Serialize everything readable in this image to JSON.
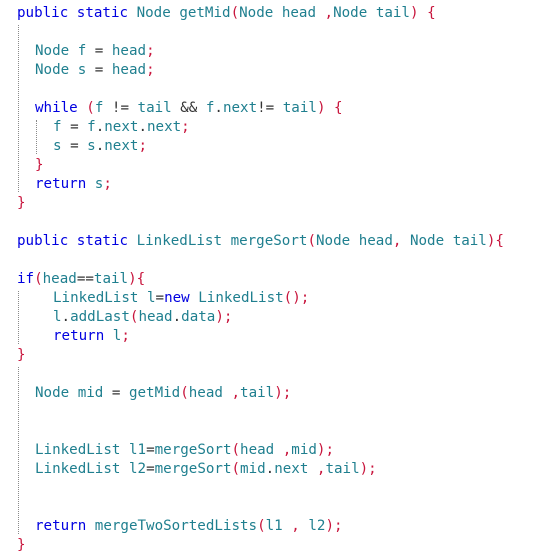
{
  "theme": {
    "keyword": "#0000e0",
    "identifier": "#1f7f8f",
    "punctuation": "#c8143c",
    "operator": "#333333",
    "background": "#ffffff"
  },
  "lines": [
    {
      "indent": 0,
      "tokens": [
        {
          "t": "public",
          "k": "kw"
        },
        {
          "t": " ",
          "k": "plain"
        },
        {
          "t": "static",
          "k": "kw"
        },
        {
          "t": " ",
          "k": "plain"
        },
        {
          "t": "Node",
          "k": "id"
        },
        {
          "t": " ",
          "k": "plain"
        },
        {
          "t": "getMid",
          "k": "id"
        },
        {
          "t": "(",
          "k": "punc"
        },
        {
          "t": "Node",
          "k": "id"
        },
        {
          "t": " ",
          "k": "plain"
        },
        {
          "t": "head",
          "k": "id"
        },
        {
          "t": " ,",
          "k": "punc"
        },
        {
          "t": "Node",
          "k": "id"
        },
        {
          "t": " ",
          "k": "plain"
        },
        {
          "t": "tail",
          "k": "id"
        },
        {
          "t": ")",
          "k": "punc"
        },
        {
          "t": " ",
          "k": "plain"
        },
        {
          "t": "{",
          "k": "punc"
        }
      ]
    },
    {
      "indent": 0,
      "tokens": []
    },
    {
      "indent": 1,
      "tokens": [
        {
          "t": "Node",
          "k": "id"
        },
        {
          "t": " ",
          "k": "plain"
        },
        {
          "t": "f",
          "k": "id"
        },
        {
          "t": " = ",
          "k": "op"
        },
        {
          "t": "head",
          "k": "id"
        },
        {
          "t": ";",
          "k": "punc"
        }
      ]
    },
    {
      "indent": 1,
      "tokens": [
        {
          "t": "Node",
          "k": "id"
        },
        {
          "t": " ",
          "k": "plain"
        },
        {
          "t": "s",
          "k": "id"
        },
        {
          "t": " = ",
          "k": "op"
        },
        {
          "t": "head",
          "k": "id"
        },
        {
          "t": ";",
          "k": "punc"
        }
      ]
    },
    {
      "indent": 0,
      "tokens": []
    },
    {
      "indent": 1,
      "tokens": [
        {
          "t": "while",
          "k": "kw"
        },
        {
          "t": " ",
          "k": "plain"
        },
        {
          "t": "(",
          "k": "punc"
        },
        {
          "t": "f",
          "k": "id"
        },
        {
          "t": " != ",
          "k": "op"
        },
        {
          "t": "tail",
          "k": "id"
        },
        {
          "t": " && ",
          "k": "op"
        },
        {
          "t": "f",
          "k": "id"
        },
        {
          "t": ".",
          "k": "op"
        },
        {
          "t": "next",
          "k": "id"
        },
        {
          "t": "!= ",
          "k": "op"
        },
        {
          "t": "tail",
          "k": "id"
        },
        {
          "t": ")",
          "k": "punc"
        },
        {
          "t": " ",
          "k": "plain"
        },
        {
          "t": "{",
          "k": "punc"
        }
      ]
    },
    {
      "indent": 2,
      "tokens": [
        {
          "t": "f",
          "k": "id"
        },
        {
          "t": " = ",
          "k": "op"
        },
        {
          "t": "f",
          "k": "id"
        },
        {
          "t": ".",
          "k": "op"
        },
        {
          "t": "next",
          "k": "id"
        },
        {
          "t": ".",
          "k": "op"
        },
        {
          "t": "next",
          "k": "id"
        },
        {
          "t": ";",
          "k": "punc"
        }
      ]
    },
    {
      "indent": 2,
      "tokens": [
        {
          "t": "s",
          "k": "id"
        },
        {
          "t": " = ",
          "k": "op"
        },
        {
          "t": "s",
          "k": "id"
        },
        {
          "t": ".",
          "k": "op"
        },
        {
          "t": "next",
          "k": "id"
        },
        {
          "t": ";",
          "k": "punc"
        }
      ]
    },
    {
      "indent": 1,
      "tokens": [
        {
          "t": "}",
          "k": "punc"
        }
      ]
    },
    {
      "indent": 1,
      "tokens": [
        {
          "t": "return",
          "k": "kw"
        },
        {
          "t": " ",
          "k": "plain"
        },
        {
          "t": "s",
          "k": "id"
        },
        {
          "t": ";",
          "k": "punc"
        }
      ]
    },
    {
      "indent": 0,
      "tokens": [
        {
          "t": "}",
          "k": "punc"
        }
      ]
    },
    {
      "indent": 0,
      "tokens": []
    },
    {
      "indent": 0,
      "tokens": [
        {
          "t": "public",
          "k": "kw"
        },
        {
          "t": " ",
          "k": "plain"
        },
        {
          "t": "static",
          "k": "kw"
        },
        {
          "t": " ",
          "k": "plain"
        },
        {
          "t": "LinkedList",
          "k": "id"
        },
        {
          "t": " ",
          "k": "plain"
        },
        {
          "t": "mergeSort",
          "k": "id"
        },
        {
          "t": "(",
          "k": "punc"
        },
        {
          "t": "Node",
          "k": "id"
        },
        {
          "t": " ",
          "k": "plain"
        },
        {
          "t": "head",
          "k": "id"
        },
        {
          "t": ", ",
          "k": "punc"
        },
        {
          "t": "Node",
          "k": "id"
        },
        {
          "t": " ",
          "k": "plain"
        },
        {
          "t": "tail",
          "k": "id"
        },
        {
          "t": ")",
          "k": "punc"
        },
        {
          "t": "{",
          "k": "punc"
        }
      ]
    },
    {
      "indent": 0,
      "tokens": []
    },
    {
      "indent": 0,
      "tokens": [
        {
          "t": "if",
          "k": "kw"
        },
        {
          "t": "(",
          "k": "punc"
        },
        {
          "t": "head",
          "k": "id"
        },
        {
          "t": "==",
          "k": "op"
        },
        {
          "t": "tail",
          "k": "id"
        },
        {
          "t": ")",
          "k": "punc"
        },
        {
          "t": "{",
          "k": "punc"
        }
      ]
    },
    {
      "indent": 2,
      "tokens": [
        {
          "t": "LinkedList",
          "k": "id"
        },
        {
          "t": " ",
          "k": "plain"
        },
        {
          "t": "l",
          "k": "id"
        },
        {
          "t": "=",
          "k": "op"
        },
        {
          "t": "new",
          "k": "kw"
        },
        {
          "t": " ",
          "k": "plain"
        },
        {
          "t": "LinkedList",
          "k": "id"
        },
        {
          "t": "();",
          "k": "punc"
        }
      ]
    },
    {
      "indent": 2,
      "tokens": [
        {
          "t": "l",
          "k": "id"
        },
        {
          "t": ".",
          "k": "op"
        },
        {
          "t": "addLast",
          "k": "id"
        },
        {
          "t": "(",
          "k": "punc"
        },
        {
          "t": "head",
          "k": "id"
        },
        {
          "t": ".",
          "k": "op"
        },
        {
          "t": "data",
          "k": "id"
        },
        {
          "t": ");",
          "k": "punc"
        }
      ]
    },
    {
      "indent": 2,
      "tokens": [
        {
          "t": "return",
          "k": "kw"
        },
        {
          "t": " ",
          "k": "plain"
        },
        {
          "t": "l",
          "k": "id"
        },
        {
          "t": ";",
          "k": "punc"
        }
      ]
    },
    {
      "indent": 0,
      "tokens": [
        {
          "t": "}",
          "k": "punc"
        }
      ]
    },
    {
      "indent": 0,
      "tokens": []
    },
    {
      "indent": 1,
      "tokens": [
        {
          "t": "Node",
          "k": "id"
        },
        {
          "t": " ",
          "k": "plain"
        },
        {
          "t": "mid",
          "k": "id"
        },
        {
          "t": " = ",
          "k": "op"
        },
        {
          "t": "getMid",
          "k": "id"
        },
        {
          "t": "(",
          "k": "punc"
        },
        {
          "t": "head",
          "k": "id"
        },
        {
          "t": " ,",
          "k": "punc"
        },
        {
          "t": "tail",
          "k": "id"
        },
        {
          "t": ");",
          "k": "punc"
        }
      ]
    },
    {
      "indent": 0,
      "tokens": []
    },
    {
      "indent": 0,
      "tokens": []
    },
    {
      "indent": 1,
      "tokens": [
        {
          "t": "LinkedList",
          "k": "id"
        },
        {
          "t": " ",
          "k": "plain"
        },
        {
          "t": "l1",
          "k": "id"
        },
        {
          "t": "=",
          "k": "op"
        },
        {
          "t": "mergeSort",
          "k": "id"
        },
        {
          "t": "(",
          "k": "punc"
        },
        {
          "t": "head",
          "k": "id"
        },
        {
          "t": " ,",
          "k": "punc"
        },
        {
          "t": "mid",
          "k": "id"
        },
        {
          "t": ");",
          "k": "punc"
        }
      ]
    },
    {
      "indent": 1,
      "tokens": [
        {
          "t": "LinkedList",
          "k": "id"
        },
        {
          "t": " ",
          "k": "plain"
        },
        {
          "t": "l2",
          "k": "id"
        },
        {
          "t": "=",
          "k": "op"
        },
        {
          "t": "mergeSort",
          "k": "id"
        },
        {
          "t": "(",
          "k": "punc"
        },
        {
          "t": "mid",
          "k": "id"
        },
        {
          "t": ".",
          "k": "op"
        },
        {
          "t": "next",
          "k": "id"
        },
        {
          "t": " ,",
          "k": "punc"
        },
        {
          "t": "tail",
          "k": "id"
        },
        {
          "t": ");",
          "k": "punc"
        }
      ]
    },
    {
      "indent": 0,
      "tokens": []
    },
    {
      "indent": 0,
      "tokens": []
    },
    {
      "indent": 1,
      "tokens": [
        {
          "t": "return",
          "k": "kw"
        },
        {
          "t": " ",
          "k": "plain"
        },
        {
          "t": "mergeTwoSortedLists",
          "k": "id"
        },
        {
          "t": "(",
          "k": "punc"
        },
        {
          "t": "l1",
          "k": "id"
        },
        {
          "t": " , ",
          "k": "punc"
        },
        {
          "t": "l2",
          "k": "id"
        },
        {
          "t": ");",
          "k": "punc"
        }
      ]
    },
    {
      "indent": 0,
      "tokens": [
        {
          "t": "}",
          "k": "punc"
        }
      ]
    }
  ]
}
